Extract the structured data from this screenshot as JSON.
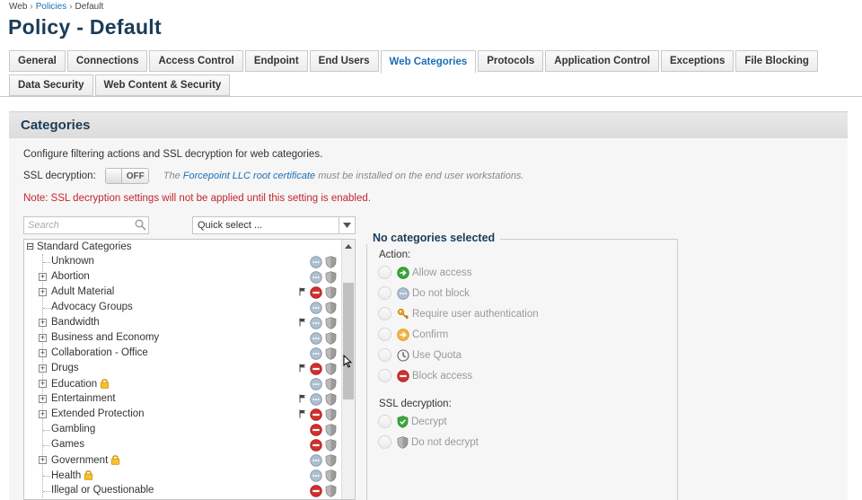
{
  "breadcrumb": {
    "home": "Web",
    "section": "Policies",
    "current": "Default",
    "sep": "›"
  },
  "page_title": "Policy - Default",
  "tabs_row1": [
    "General",
    "Connections",
    "Access Control",
    "Endpoint",
    "End Users",
    "Web Categories",
    "Protocols",
    "Application Control",
    "Exceptions",
    "File Blocking"
  ],
  "tabs_row2": [
    "Data Security",
    "Web Content & Security"
  ],
  "active_tab": "Web Categories",
  "panel": {
    "title": "Categories",
    "intro": "Configure filtering actions and SSL decryption for web categories.",
    "ssl_label": "SSL decryption:",
    "toggle_label": "OFF",
    "ssl_note_pre": "The ",
    "ssl_note_link": "Forcepoint LLC root certificate",
    "ssl_note_post": " must be installed on the end user workstations.",
    "warning": "Note: SSL decryption settings will not be applied until this setting is enabled."
  },
  "search": {
    "placeholder": "Search"
  },
  "quick_select": {
    "value": "Quick select ..."
  },
  "tree": {
    "root": "Standard Categories",
    "root_toggle": "⊟",
    "expand_glyph": "+",
    "items": [
      {
        "name": "Unknown",
        "expandable": false,
        "locked": false,
        "flag": false,
        "action": "not-block"
      },
      {
        "name": "Abortion",
        "expandable": true,
        "locked": false,
        "flag": false,
        "action": "not-block"
      },
      {
        "name": "Adult Material",
        "expandable": true,
        "locked": false,
        "flag": true,
        "action": "block"
      },
      {
        "name": "Advocacy Groups",
        "expandable": false,
        "locked": false,
        "flag": false,
        "action": "not-block"
      },
      {
        "name": "Bandwidth",
        "expandable": true,
        "locked": false,
        "flag": true,
        "action": "not-block"
      },
      {
        "name": "Business and Economy",
        "expandable": true,
        "locked": false,
        "flag": false,
        "action": "not-block"
      },
      {
        "name": "Collaboration - Office",
        "expandable": true,
        "locked": false,
        "flag": false,
        "action": "not-block"
      },
      {
        "name": "Drugs",
        "expandable": true,
        "locked": false,
        "flag": true,
        "action": "block"
      },
      {
        "name": "Education",
        "expandable": true,
        "locked": true,
        "flag": false,
        "action": "not-block"
      },
      {
        "name": "Entertainment",
        "expandable": true,
        "locked": false,
        "flag": true,
        "action": "not-block"
      },
      {
        "name": "Extended Protection",
        "expandable": true,
        "locked": false,
        "flag": true,
        "action": "block"
      },
      {
        "name": "Gambling",
        "expandable": false,
        "locked": false,
        "flag": false,
        "action": "block"
      },
      {
        "name": "Games",
        "expandable": false,
        "locked": false,
        "flag": false,
        "action": "block"
      },
      {
        "name": "Government",
        "expandable": true,
        "locked": true,
        "flag": false,
        "action": "not-block"
      },
      {
        "name": "Health",
        "expandable": false,
        "locked": true,
        "flag": false,
        "action": "not-block"
      },
      {
        "name": "Illegal or Questionable",
        "expandable": false,
        "locked": false,
        "flag": false,
        "action": "block"
      }
    ]
  },
  "details": {
    "title": "No categories selected",
    "action_label": "Action:",
    "actions": [
      {
        "label": "Allow access",
        "icon": "allow-icon"
      },
      {
        "label": "Do not block",
        "icon": "not-block-icon"
      },
      {
        "label": "Require user authentication",
        "icon": "key-icon"
      },
      {
        "label": "Confirm",
        "icon": "confirm-icon"
      },
      {
        "label": "Use Quota",
        "icon": "clock-icon"
      },
      {
        "label": "Block access",
        "icon": "block-icon"
      }
    ],
    "ssl_label": "SSL decryption:",
    "ssl_options": [
      {
        "label": "Decrypt",
        "icon": "decrypt-shield-icon"
      },
      {
        "label": "Do not decrypt",
        "icon": "no-decrypt-shield-icon"
      }
    ]
  },
  "colors": {
    "title": "#1c3b57",
    "link": "#1a6fb5",
    "warning": "#c0272d",
    "block": "#d32f2f",
    "allow": "#3aa83a"
  }
}
